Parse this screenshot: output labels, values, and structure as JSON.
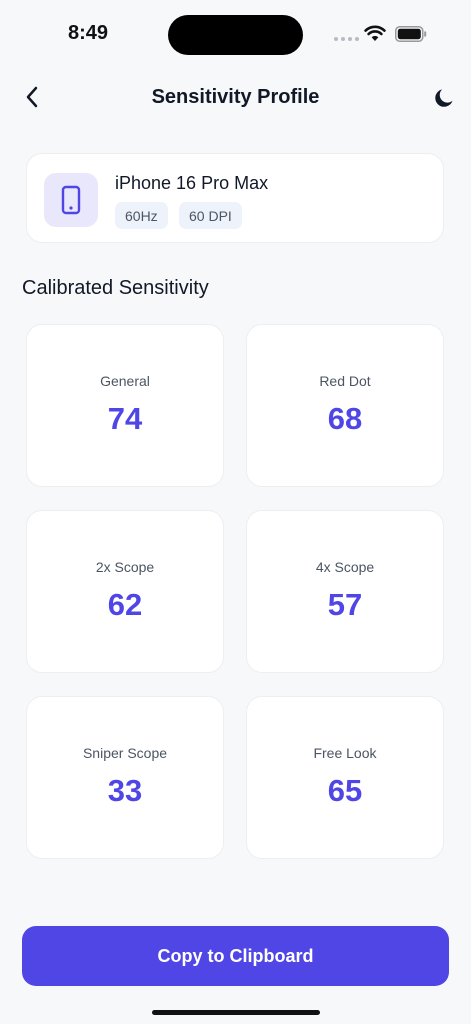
{
  "status_bar": {
    "time": "8:49",
    "icons": [
      "cellular-signal-icon",
      "wifi-icon",
      "battery-icon"
    ]
  },
  "nav": {
    "title": "Sensitivity Profile",
    "back_icon": "chevron-left-icon",
    "theme_icon": "moon-icon"
  },
  "device": {
    "name": "iPhone 16 Pro Max",
    "icon": "smartphone-icon",
    "refresh_rate": "60Hz",
    "dpi": "60 DPI"
  },
  "section_title": "Calibrated Sensitivity",
  "sensitivities": [
    {
      "label": "General",
      "value": "74"
    },
    {
      "label": "Red Dot",
      "value": "68"
    },
    {
      "label": "2x Scope",
      "value": "62"
    },
    {
      "label": "4x Scope",
      "value": "57"
    },
    {
      "label": "Sniper Scope",
      "value": "33"
    },
    {
      "label": "Free Look",
      "value": "65"
    }
  ],
  "copy_button_label": "Copy to Clipboard",
  "colors": {
    "accent": "#4f46e5",
    "icon_bg": "#e8e7fb",
    "background": "#f7f8fa"
  }
}
